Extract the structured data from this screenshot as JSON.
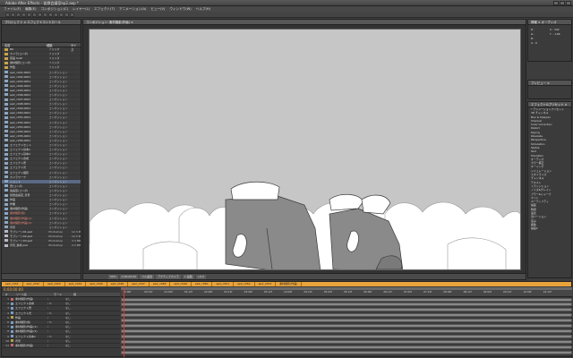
{
  "window": {
    "title": "Adobe After Effects - 仮想会議室ep2.aep *"
  },
  "menu": [
    "ファイル(F)",
    "編集(E)",
    "コンポジション(C)",
    "レイヤー(L)",
    "エフェクト(T)",
    "アニメーション(A)",
    "ビュー(V)",
    "ウィンドウ(W)",
    "ヘルプ(H)"
  ],
  "project": {
    "tab": "プロジェクト × エフェクトコントロール",
    "columns": [
      "名前",
      "種類",
      "サイズ"
    ],
    "items": [
      {
        "name": "BG",
        "type": "フォルダ",
        "size": "",
        "icon": "folder"
      },
      {
        "name": "カメラ(コンポ)",
        "type": "フォルダ",
        "size": "",
        "icon": "folder"
      },
      {
        "name": "原画 Solid",
        "type": "フォルダ",
        "size": "",
        "icon": "folder"
      },
      {
        "name": "素材撮影(コンポ)",
        "type": "フォルダ",
        "size": "",
        "icon": "folder"
      },
      {
        "name": "作監",
        "type": "フォルダ",
        "size": "",
        "icon": "folder"
      },
      {
        "name": "ep2_c041-0001",
        "type": "コンポジション",
        "size": "",
        "icon": "comp"
      },
      {
        "name": "ep2_c042-0001",
        "type": "コンポジション",
        "size": "",
        "icon": "comp"
      },
      {
        "name": "ep2_c043-0001",
        "type": "コンポジション",
        "size": "",
        "icon": "comp"
      },
      {
        "name": "ep2_c044-0001",
        "type": "コンポジション",
        "size": "",
        "icon": "comp"
      },
      {
        "name": "ep2_c045-0001",
        "type": "コンポジション",
        "size": "",
        "icon": "comp"
      },
      {
        "name": "ep2_c046-0001",
        "type": "コンポジション",
        "size": "",
        "icon": "comp"
      },
      {
        "name": "ep2_c047-0001",
        "type": "コンポジション",
        "size": "",
        "icon": "comp"
      },
      {
        "name": "ep2_c048-0001",
        "type": "コンポジション",
        "size": "",
        "icon": "comp"
      },
      {
        "name": "ep2_c049-0001",
        "type": "コンポジション",
        "size": "",
        "icon": "comp"
      },
      {
        "name": "ep2_c050-0001",
        "type": "コンポジション",
        "size": "",
        "icon": "comp"
      },
      {
        "name": "ep2_c051-0001",
        "type": "コンポジション",
        "size": "",
        "icon": "comp"
      },
      {
        "name": "ep2_c052-0001",
        "type": "コンポジション",
        "size": "",
        "icon": "comp"
      },
      {
        "name": "ep2_c053-0001",
        "type": "コンポジション",
        "size": "",
        "icon": "comp"
      },
      {
        "name": "ep2_c054-0001",
        "type": "コンポジション",
        "size": "",
        "icon": "comp"
      },
      {
        "name": "ep2_c055-0001",
        "type": "コンポジション",
        "size": "",
        "icon": "comp"
      },
      {
        "name": "ep2_c056-0001",
        "type": "コンポジション",
        "size": "",
        "icon": "comp"
      },
      {
        "name": "エフェクトセット",
        "type": "コンポジション",
        "size": "",
        "icon": "comp"
      },
      {
        "name": "エフェクト基本1",
        "type": "コンポジション",
        "size": "",
        "icon": "comp"
      },
      {
        "name": "エフェクト基本2",
        "type": "コンポジション",
        "size": "",
        "icon": "comp"
      },
      {
        "name": "エフェクト合成",
        "type": "コンポジション",
        "size": "",
        "icon": "comp"
      },
      {
        "name": "エフェクト雲",
        "type": "コンポジション",
        "size": "",
        "icon": "comp"
      },
      {
        "name": "エフェクト光",
        "type": "コンポジション",
        "size": "",
        "icon": "comp"
      },
      {
        "name": "エフェクト撮影",
        "type": "コンポジション",
        "size": "",
        "icon": "comp"
      },
      {
        "name": "カメラワーク",
        "type": "コンポジション",
        "size": "",
        "icon": "comp"
      },
      {
        "name": "ショット",
        "type": "コンポジション",
        "size": "",
        "icon": "comp"
      },
      {
        "name": "雲(コンポ)",
        "type": "コンポジション",
        "size": "",
        "icon": "comp"
      },
      {
        "name": "会議室(コンポ)",
        "type": "コンポジション",
        "size": "",
        "icon": "comp"
      },
      {
        "name": "仮想会議室_背景",
        "type": "コンポジション",
        "size": "",
        "icon": "comp"
      },
      {
        "name": "作画",
        "type": "コンポジション",
        "size": "",
        "icon": "comp"
      },
      {
        "name": "作業",
        "type": "コンポジション",
        "size": "",
        "icon": "comp"
      },
      {
        "name": "素材撮影(作画)",
        "type": "コンポジション",
        "size": "",
        "icon": "comp"
      },
      {
        "name": "素材撮影(仮)",
        "type": "コンポジション",
        "size": "",
        "icon": "comp"
      },
      {
        "name": "素材撮影(作画)(1)",
        "type": "コンポジション",
        "size": "",
        "icon": "comp"
      },
      {
        "name": "素材撮影(作画)(2)",
        "type": "コンポジション",
        "size": "",
        "icon": "comp"
      },
      {
        "name": "背景",
        "type": "コンポジション",
        "size": "",
        "icon": "comp"
      },
      {
        "name": "モブシーン01.psd",
        "type": "Photoshop",
        "size": "12.3 MB",
        "icon": "file"
      },
      {
        "name": "モブシーン02.psd",
        "type": "Photoshop",
        "size": "12.3 MB",
        "icon": "file"
      },
      {
        "name": "モブシーン03.psd",
        "type": "Photoshop",
        "size": "3.3 MB",
        "icon": "file"
      },
      {
        "name": "背景_素材.psd",
        "type": "Photoshop",
        "size": "3.3 MB",
        "icon": "file"
      }
    ],
    "selected_index": 29,
    "red_indices": [
      36,
      37,
      38
    ]
  },
  "viewer": {
    "tab": "コンポジション: 素材撮影(作画) ×",
    "footer": [
      "50%",
      "0:00:00:00",
      "フル画質",
      "アクティブカメラ",
      "1 画面",
      "+0.0"
    ]
  },
  "info_panel": {
    "tab": "情報 × オーディオ",
    "values": [
      "R :",
      "G :",
      "B :",
      "A : 0",
      "X : 342",
      "Y : -106"
    ]
  },
  "preview_panel": {
    "tab": "プレビュー ×"
  },
  "effects_panel": {
    "tab": "エフェクト&プリセット ×",
    "items": [
      "* アニメーションプリセット",
      "3D チャンネル",
      "Blur & Sharpen",
      "Channel",
      "Color Correction",
      "Distort",
      "Keying",
      "Obsolete",
      "Perspective",
      "Simulation",
      "Stylize",
      "Text",
      "Transition",
      "オーディオ",
      "カラー補正",
      "キーイング",
      "シミュレーション",
      "スタイライズ",
      "チャンネル",
      "テキスト",
      "トランジション",
      "ノイズ&グレイン",
      "ブラー&シャープ",
      "マット",
      "ユーティリティ",
      "描画",
      "時間",
      "遠近",
      "旧バージョン",
      "歪み",
      "補助",
      "描画2"
    ]
  },
  "timeline": {
    "tabs": [
      "ep2_c041",
      "ep2_c042",
      "ep2_c043",
      "ep2_c044",
      "ep2_c045",
      "ep2_c046",
      "ep2_c047",
      "ep2_c048",
      "ep2_c049",
      "ep2_c050",
      "ep2_c051",
      "ep2_c052",
      "ep2_c053",
      "素材撮影(作画)"
    ],
    "time": "0:00:00:00",
    "columns": [
      "#",
      "ソース名",
      "モード",
      "親"
    ],
    "layers": [
      {
        "num": "1",
        "name": "素材撮影(作画)",
        "switches": "/",
        "parent": "なし",
        "color": "#c46a6a"
      },
      {
        "num": "2",
        "name": "エフェクト合成",
        "switches": "/ fx",
        "parent": "なし",
        "color": "#7a9cc4"
      },
      {
        "num": "3",
        "name": "エフェクト雲",
        "switches": "/",
        "parent": "なし",
        "color": "#7a9cc4"
      },
      {
        "num": "4",
        "name": "エフェクト光",
        "switches": "/ fx",
        "parent": "なし",
        "color": "#7a9cc4"
      },
      {
        "num": "5",
        "name": "作画",
        "switches": "/",
        "parent": "なし",
        "color": "#b5a04a"
      },
      {
        "num": "6",
        "name": "素材撮影(仮)",
        "switches": "/ fx",
        "parent": "なし",
        "color": "#7a9cc4"
      },
      {
        "num": "7",
        "name": "素材撮影(作画)(1)",
        "switches": "/",
        "parent": "なし",
        "color": "#7a9cc4"
      },
      {
        "num": "8",
        "name": "素材撮影(作画)(2)",
        "switches": "/",
        "parent": "なし",
        "color": "#7a9cc4"
      },
      {
        "num": "9",
        "name": "エフェクト基本1",
        "switches": "/ fx",
        "parent": "なし",
        "color": "#7a9cc4"
      },
      {
        "num": "10",
        "name": "背景",
        "switches": "/",
        "parent": "なし",
        "color": "#b5a04a"
      },
      {
        "num": "11",
        "name": "素材撮影(作画)",
        "switches": "/",
        "parent": "なし",
        "color": "#c46a6a"
      }
    ],
    "ruler": [
      "0:00f",
      "00:12f",
      "01:00f",
      "01:12f",
      "02:00f",
      "02:12f",
      "03:00f",
      "03:12f",
      "04:00f",
      "04:12f",
      "05:00f",
      "05:12f",
      "06:00f",
      "06:12f",
      "07:00f",
      "07:12f",
      "08:00f",
      "08:12f",
      "09:00f",
      "09:12f",
      "10:00f",
      "10:12f"
    ]
  },
  "colors": {
    "accent": "#e8a33a",
    "canvas": "#c6c6c6",
    "figure": "#8a8a8a",
    "cloud": "#ffffff"
  }
}
